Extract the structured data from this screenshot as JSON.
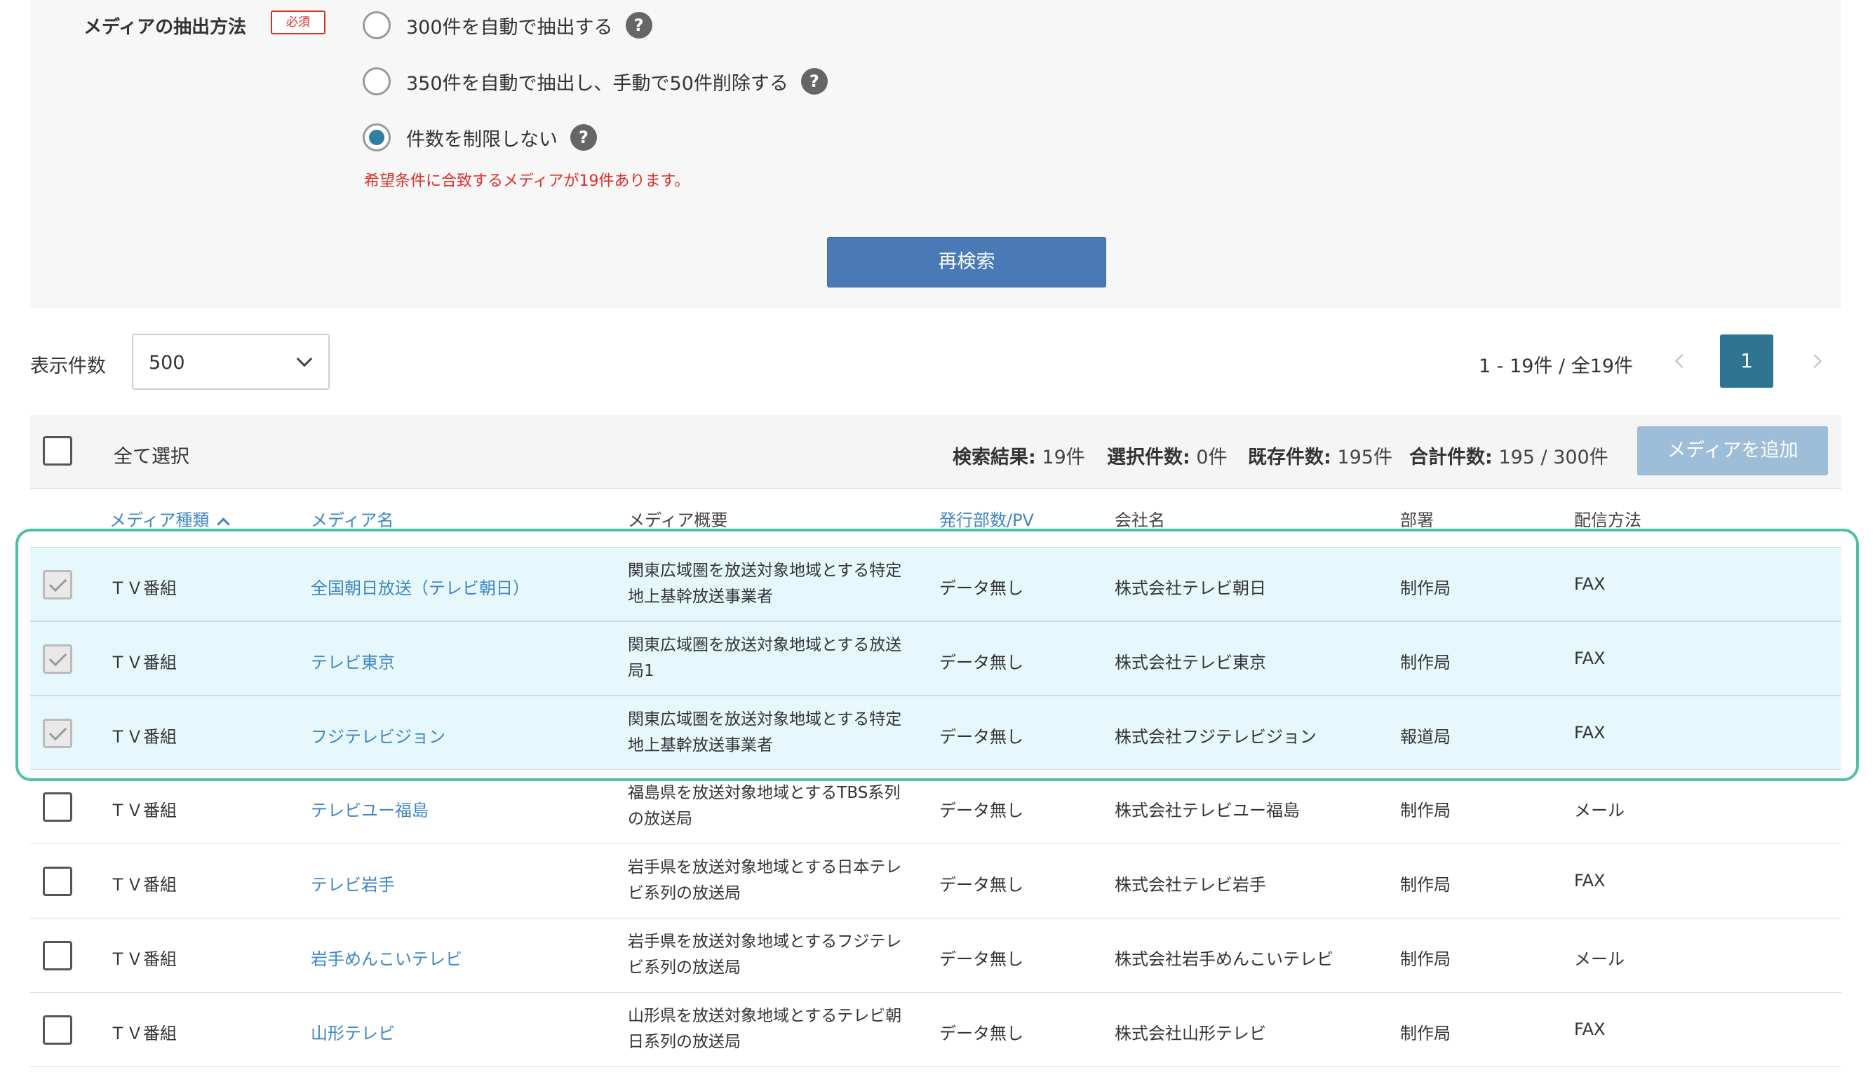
{
  "form": {
    "label": "メディアの抽出方法",
    "required_badge": "必須",
    "options": [
      {
        "label": "300件を自動で抽出する",
        "checked": false
      },
      {
        "label": "350件を自動で抽出し、手動で50件削除する",
        "checked": false
      },
      {
        "label": "件数を制限しない",
        "checked": true
      }
    ],
    "help_icon": "?",
    "match_notice": "希望条件に合致するメディアが19件あります。",
    "research_button": "再検索"
  },
  "toolbar": {
    "display_count_label": "表示件数",
    "display_count_value": "500",
    "result_range": "1 - 19件 / 全19件",
    "current_page": "1"
  },
  "action_bar": {
    "select_all_label": "全て選択",
    "stats": {
      "search_label": "検索結果:",
      "search_value": "19件",
      "selected_label": "選択件数:",
      "selected_value": "0件",
      "existing_label": "既存件数:",
      "existing_value": "195件",
      "total_label": "合計件数:",
      "total_value": "195 / 300件"
    },
    "add_media_button": "メディアを追加"
  },
  "table": {
    "headers": {
      "media_type": "メディア種類",
      "media_name": "メディア名",
      "summary": "メディア概要",
      "circulation": "発行部数/PV",
      "company": "会社名",
      "department": "部署",
      "delivery": "配信方法"
    },
    "rows": [
      {
        "checked": true,
        "type": "ＴＶ番組",
        "name": "全国朝日放送（テレビ朝日）",
        "summary": "関東広域圏を放送対象地域とする特定地上基幹放送事業者",
        "circulation": "データ無し",
        "company": "株式会社テレビ朝日",
        "department": "制作局",
        "delivery": "FAX"
      },
      {
        "checked": true,
        "type": "ＴＶ番組",
        "name": "テレビ東京",
        "summary": "関東広域圏を放送対象地域とする放送局1",
        "circulation": "データ無し",
        "company": "株式会社テレビ東京",
        "department": "制作局",
        "delivery": "FAX"
      },
      {
        "checked": true,
        "type": "ＴＶ番組",
        "name": "フジテレビジョン",
        "summary": "関東広域圏を放送対象地域とする特定地上基幹放送事業者",
        "circulation": "データ無し",
        "company": "株式会社フジテレビジョン",
        "department": "報道局",
        "delivery": "FAX"
      },
      {
        "checked": false,
        "type": "ＴＶ番組",
        "name": "テレビユー福島",
        "summary": "福島県を放送対象地域とするTBS系列の放送局",
        "circulation": "データ無し",
        "company": "株式会社テレビユー福島",
        "department": "制作局",
        "delivery": "メール"
      },
      {
        "checked": false,
        "type": "ＴＶ番組",
        "name": "テレビ岩手",
        "summary": "岩手県を放送対象地域とする日本テレビ系列の放送局",
        "circulation": "データ無し",
        "company": "株式会社テレビ岩手",
        "department": "制作局",
        "delivery": "FAX"
      },
      {
        "checked": false,
        "type": "ＴＶ番組",
        "name": "岩手めんこいテレビ",
        "summary": "岩手県を放送対象地域とするフジテレビ系列の放送局",
        "circulation": "データ無し",
        "company": "株式会社岩手めんこいテレビ",
        "department": "制作局",
        "delivery": "メール"
      },
      {
        "checked": false,
        "type": "ＴＶ番組",
        "name": "山形テレビ",
        "summary": "山形県を放送対象地域とするテレビ朝日系列の放送局",
        "circulation": "データ無し",
        "company": "株式会社山形テレビ",
        "department": "制作局",
        "delivery": "FAX"
      }
    ]
  }
}
